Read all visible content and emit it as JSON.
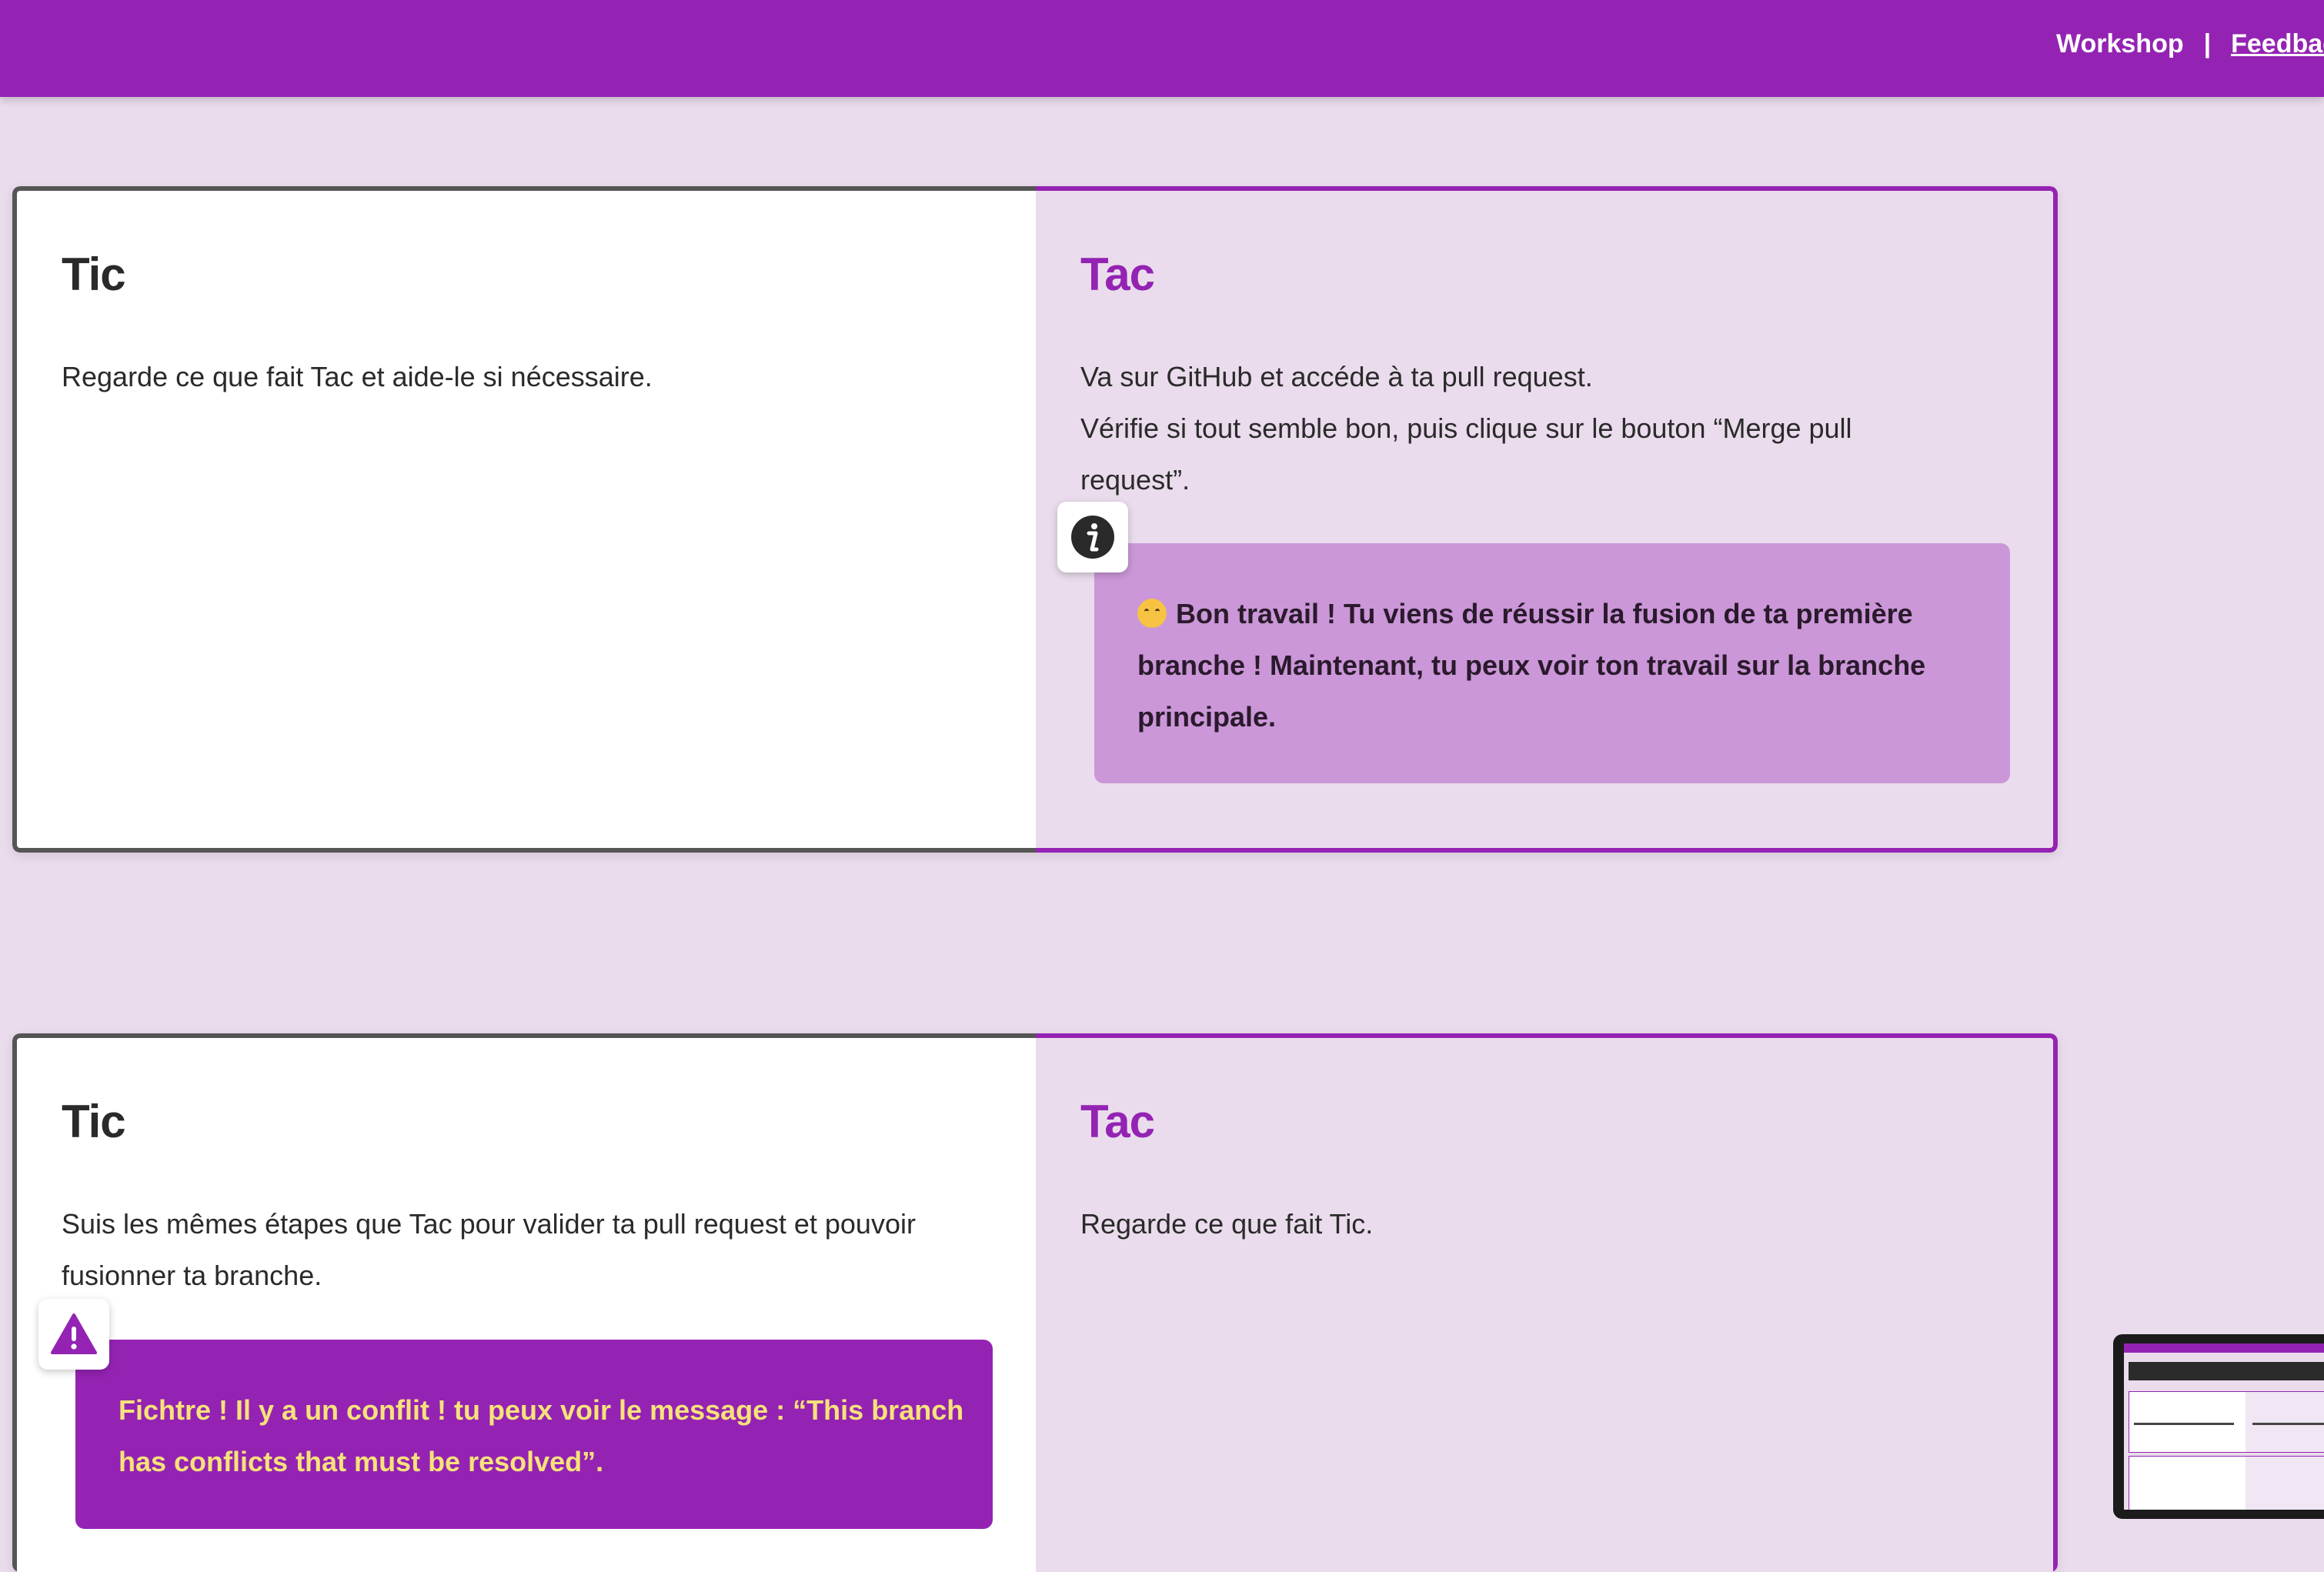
{
  "header": {
    "nav": [
      "Workshop",
      "|",
      "Feedback"
    ]
  },
  "colors": {
    "brand": "#9423b3",
    "page_background": "#eadcec",
    "callout_info": "#cb97d8",
    "warning_text": "#f7e27a"
  },
  "cards": [
    {
      "tic": {
        "title": "Tic",
        "lines": [
          "Regarde ce que fait Tac et aide-le si nécessaire."
        ]
      },
      "tac": {
        "title": "Tac",
        "lines": [
          "Va sur GitHub et accéde à ta pull request.",
          "Vérifie si tout semble bon, puis clique sur le bouton “Merge pull",
          "request”."
        ],
        "callout": {
          "icon": "info-icon",
          "emoji": "smiling-face-emoji",
          "lines": [
            "Bon travail ! Tu viens de réussir la fusion de ta première",
            "branche ! Maintenant, tu peux voir ton travail sur la branche",
            "principale."
          ]
        }
      }
    },
    {
      "tic": {
        "title": "Tic",
        "lines": [
          "Suis les mêmes étapes que Tac pour valider ta pull request et pouvoir",
          "fusionner ta branche."
        ],
        "callout": {
          "icon": "warning-icon",
          "lines": [
            "Fichtre ! Il y a un conflit ! tu peux voir le message : “This branch",
            "has conflicts that must be resolved”."
          ]
        }
      },
      "tac": {
        "title": "Tac",
        "lines": [
          "Regarde ce que fait Tic."
        ]
      }
    }
  ]
}
